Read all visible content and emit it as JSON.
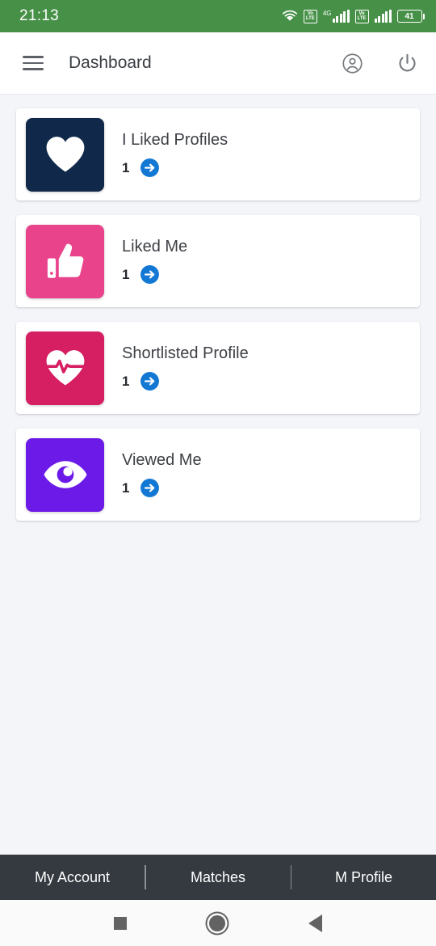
{
  "status_bar": {
    "clock": "21:13",
    "background_color": "#479047",
    "wifi_icon": "wifi-icon",
    "volte_label_top": "Vo",
    "volte_label_bottom": "LTE",
    "network_type": "4G",
    "battery_percent": "41"
  },
  "app_bar": {
    "menu_icon": "hamburger-menu-icon",
    "title": "Dashboard",
    "account_icon": "account-circle-icon",
    "power_icon": "power-icon"
  },
  "cards": [
    {
      "title": "I Liked Profiles",
      "count": "1",
      "icon": "heart-icon",
      "tile_color": "#10294a",
      "arrow_color": "#1278d4"
    },
    {
      "title": "Liked Me",
      "count": "1",
      "icon": "thumbs-up-icon",
      "tile_color": "#e8438b",
      "arrow_color": "#1278d4"
    },
    {
      "title": "Shortlisted Profile",
      "count": "1",
      "icon": "heart-pulse-icon",
      "tile_color": "#d61f62",
      "arrow_color": "#1278d4"
    },
    {
      "title": "Viewed Me",
      "count": "1",
      "icon": "eye-icon",
      "tile_color": "#6c1ae8",
      "arrow_color": "#1278d4"
    }
  ],
  "tab_bar": {
    "background_color": "#343a40",
    "items": [
      {
        "label": "My Account"
      },
      {
        "label": "Matches"
      },
      {
        "label": "M Profile"
      }
    ]
  },
  "android_nav": {
    "recents_icon": "square-recents-icon",
    "home_icon": "circle-home-icon",
    "back_icon": "triangle-back-icon"
  },
  "page_background": "#f4f5f9"
}
